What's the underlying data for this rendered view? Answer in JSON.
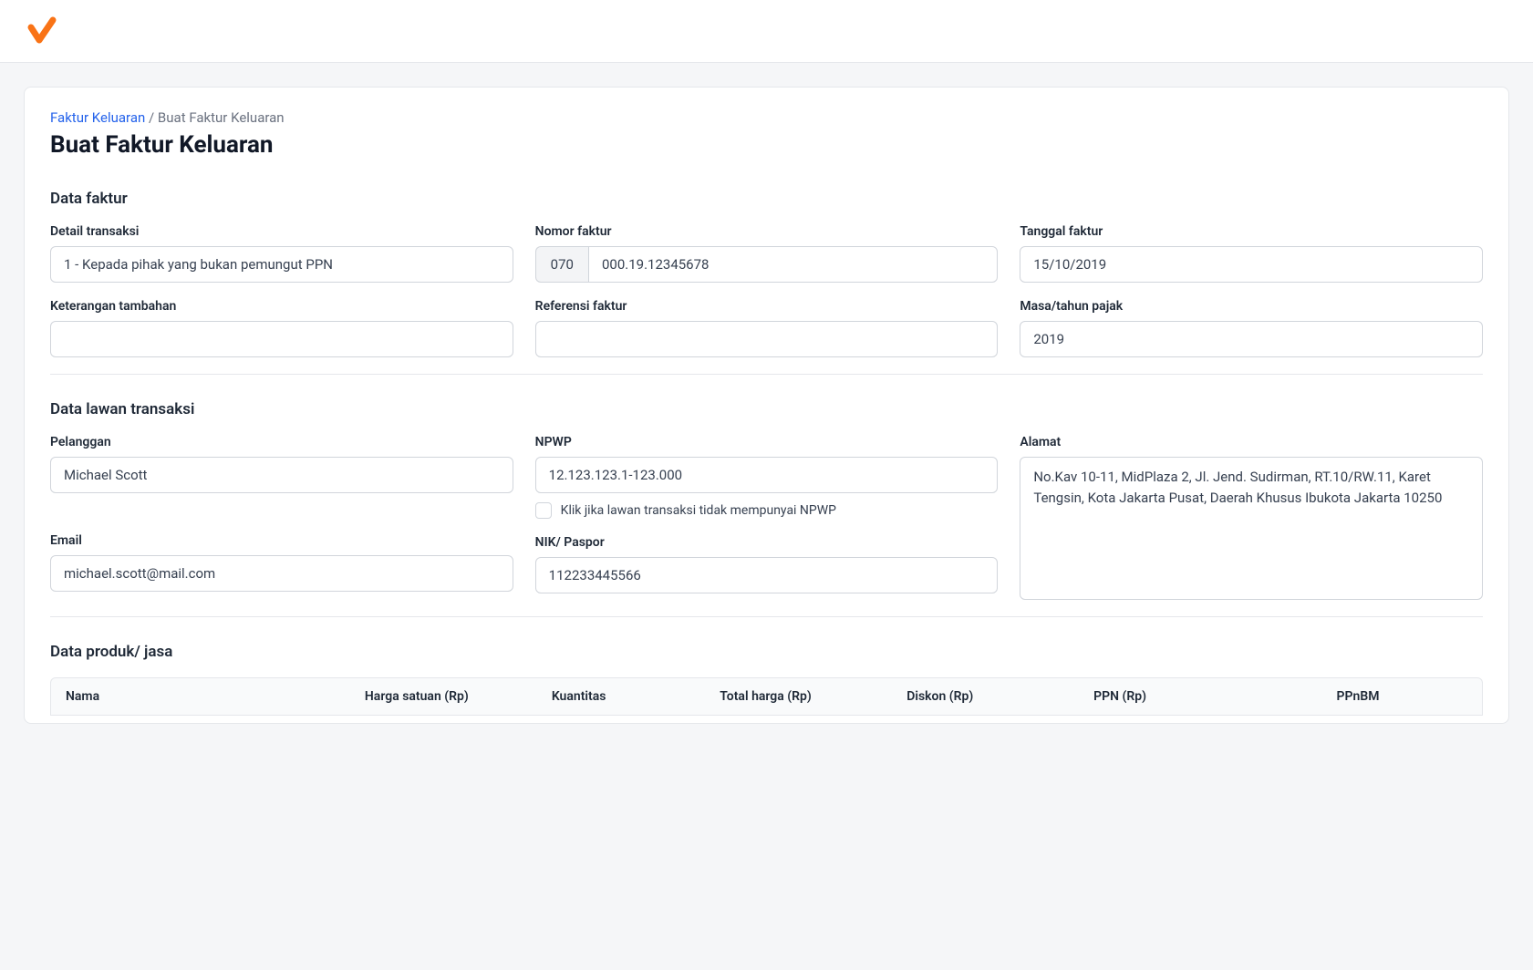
{
  "breadcrumb": {
    "root": "Faktur Keluaran",
    "separator": " / ",
    "current": "Buat Faktur Keluaran"
  },
  "page_title": "Buat Faktur Keluaran",
  "sections": {
    "data_faktur": {
      "title": "Data faktur",
      "fields": {
        "detail_transaksi": {
          "label": "Detail transaksi",
          "value": "1 - Kepada pihak yang bukan pemungut PPN"
        },
        "nomor_faktur": {
          "label": "Nomor faktur",
          "prefix": "070",
          "value": "000.19.12345678"
        },
        "tanggal_faktur": {
          "label": "Tanggal faktur",
          "value": "15/10/2019"
        },
        "keterangan_tambahan": {
          "label": "Keterangan tambahan",
          "value": ""
        },
        "referensi_faktur": {
          "label": "Referensi faktur",
          "value": ""
        },
        "masa_tahun_pajak": {
          "label": "Masa/tahun pajak",
          "value": "2019"
        }
      }
    },
    "data_lawan": {
      "title": "Data lawan transaksi",
      "fields": {
        "pelanggan": {
          "label": "Pelanggan",
          "value": "Michael Scott"
        },
        "npwp": {
          "label": "NPWP",
          "value": "12.123.123.1-123.000",
          "checkbox_label": "Klik jika lawan transaksi tidak mempunyai NPWP"
        },
        "alamat": {
          "label": "Alamat",
          "value": "No.Kav 10-11, MidPlaza 2, Jl. Jend. Sudirman, RT.10/RW.11, Karet Tengsin, Kota Jakarta Pusat, Daerah Khusus Ibukota Jakarta 10250"
        },
        "email": {
          "label": "Email",
          "value": "michael.scott@mail.com"
        },
        "nik_paspor": {
          "label": "NIK/ Paspor",
          "value": "112233445566"
        }
      }
    },
    "data_produk": {
      "title": "Data produk/ jasa",
      "columns": {
        "nama": "Nama",
        "harga_satuan": "Harga satuan (Rp)",
        "kuantitas": "Kuantitas",
        "total_harga": "Total harga (Rp)",
        "diskon": "Diskon (Rp)",
        "ppn": "PPN (Rp)",
        "ppnbm": "PPnBM"
      }
    }
  }
}
